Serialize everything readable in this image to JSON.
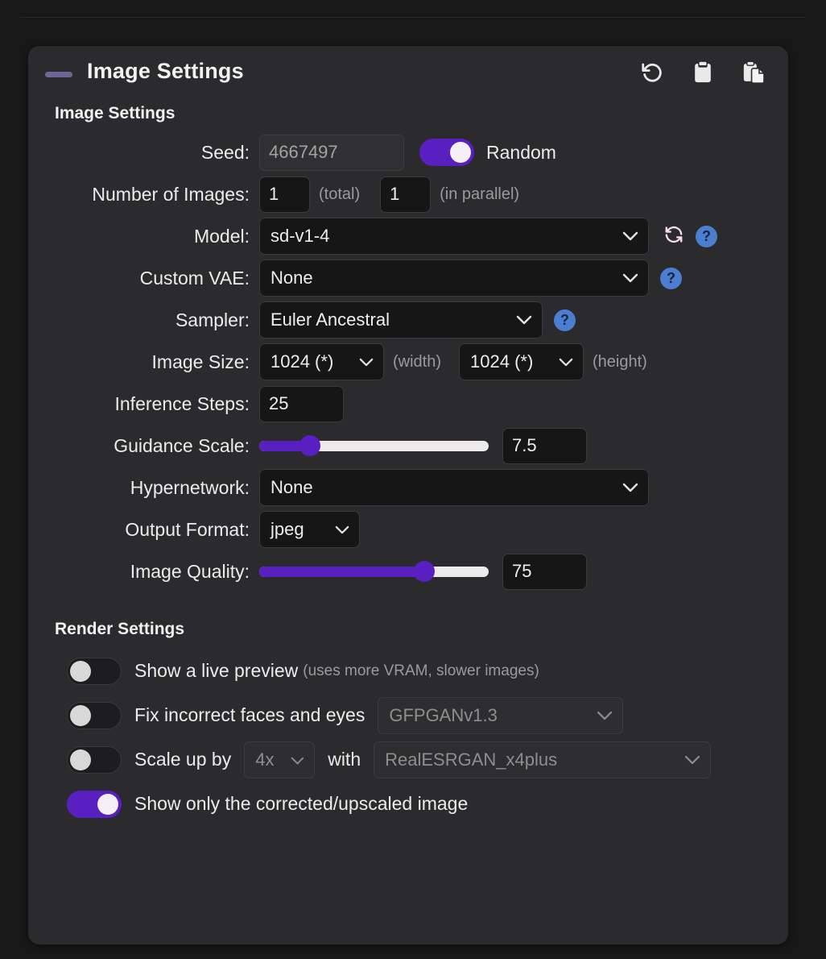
{
  "panel": {
    "title": "Image Settings",
    "collapse_icon": "minus-dash",
    "header_actions": [
      {
        "name": "reset-settings",
        "icon": "undo-icon"
      },
      {
        "name": "paste-settings",
        "icon": "clipboard-icon"
      },
      {
        "name": "copy-settings",
        "icon": "copy-icon"
      }
    ]
  },
  "image_settings": {
    "section_title": "Image Settings",
    "seed": {
      "label": "Seed:",
      "value": "4667497",
      "disabled": true,
      "random_toggle": {
        "label": "Random",
        "on": true
      }
    },
    "num_images": {
      "label": "Number of Images:",
      "total_value": "1",
      "total_hint": "(total)",
      "parallel_value": "1",
      "parallel_hint": "(in parallel)"
    },
    "model": {
      "label": "Model:",
      "value": "sd-v1-4",
      "has_refresh": true,
      "has_help": true,
      "help_label": "?"
    },
    "custom_vae": {
      "label": "Custom VAE:",
      "value": "None",
      "has_help": true,
      "help_label": "?"
    },
    "sampler": {
      "label": "Sampler:",
      "value": "Euler Ancestral",
      "has_help": true,
      "help_label": "?"
    },
    "image_size": {
      "label": "Image Size:",
      "width_value": "1024 (*)",
      "width_hint": "(width)",
      "height_value": "1024 (*)",
      "height_hint": "(height)"
    },
    "inference_steps": {
      "label": "Inference Steps:",
      "value": "25"
    },
    "guidance_scale": {
      "label": "Guidance Scale:",
      "value": "7.5",
      "percent": 22
    },
    "hypernetwork": {
      "label": "Hypernetwork:",
      "value": "None"
    },
    "output_format": {
      "label": "Output Format:",
      "value": "jpeg"
    },
    "image_quality": {
      "label": "Image Quality:",
      "value": "75",
      "percent": 72
    }
  },
  "render_settings": {
    "section_title": "Render Settings",
    "live_preview": {
      "label": "Show a live preview",
      "sub": "(uses more VRAM, slower images)",
      "on": false
    },
    "fix_faces": {
      "label": "Fix incorrect faces and eyes",
      "model_value": "GFPGANv1.3",
      "model_disabled": true,
      "on": false
    },
    "scale_up": {
      "label": "Scale up by",
      "factor_value": "4x",
      "with_label": "with",
      "upscaler_value": "RealESRGAN_x4plus",
      "disabled": true,
      "on": false
    },
    "show_only_corrected": {
      "label": "Show only the corrected/upscaled image",
      "on": true
    }
  },
  "colors": {
    "accent_purple": "#5a1fc0",
    "help_blue": "#4b7ed1",
    "panel_bg": "#2b2b2e",
    "page_bg": "#181819",
    "input_bg": "#161617"
  }
}
